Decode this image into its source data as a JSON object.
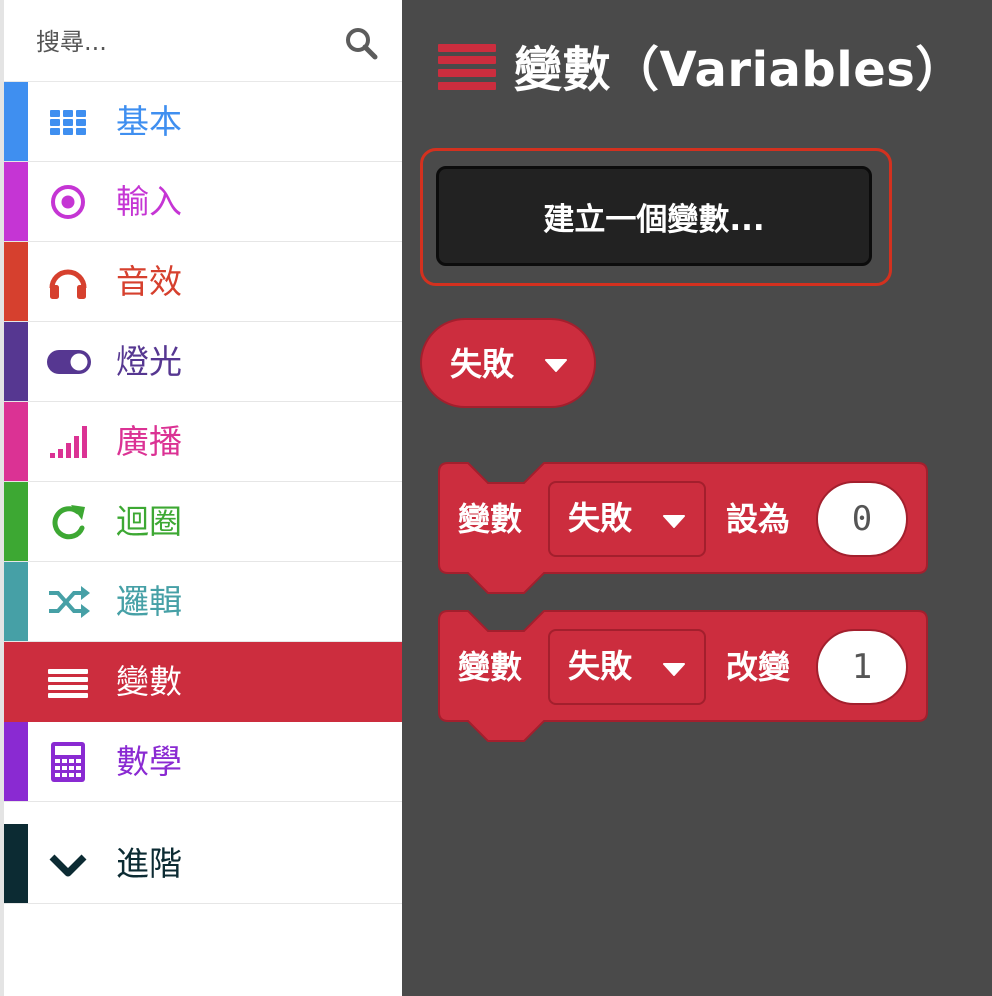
{
  "search": {
    "placeholder": "搜尋..."
  },
  "sidebar": {
    "items": [
      {
        "label": "基本",
        "icon": "grid-icon",
        "color": "#3f8ff0"
      },
      {
        "label": "輸入",
        "icon": "target-icon",
        "color": "#c535d4"
      },
      {
        "label": "音效",
        "icon": "headphones-icon",
        "color": "#d6402e"
      },
      {
        "label": "燈光",
        "icon": "toggle-icon",
        "color": "#563791"
      },
      {
        "label": "廣播",
        "icon": "signal-bars-icon",
        "color": "#db3294"
      },
      {
        "label": "迴圈",
        "icon": "refresh-icon",
        "color": "#3da833"
      },
      {
        "label": "邏輯",
        "icon": "shuffle-icon",
        "color": "#46a0a6"
      },
      {
        "label": "變數",
        "icon": "menu-lines-icon",
        "color": "#cc2d3e",
        "selected": true
      },
      {
        "label": "數學",
        "icon": "calculator-icon",
        "color": "#8a2ad2"
      },
      {
        "label": "進階",
        "icon": "chevron-down-icon",
        "color": "#0c2b33"
      }
    ]
  },
  "flyout": {
    "title": "變數（Variables）",
    "create_button": "建立一個變數...",
    "variable_name": "失敗",
    "set_block": {
      "prefix": "變數",
      "dropdown": "失敗",
      "action": "設為",
      "value": "0"
    },
    "change_block": {
      "prefix": "變數",
      "dropdown": "失敗",
      "action": "改變",
      "value": "1"
    },
    "colors": {
      "accent": "#cc2d3e",
      "highlight": "#d3311f",
      "background": "#4a4a4a"
    }
  }
}
